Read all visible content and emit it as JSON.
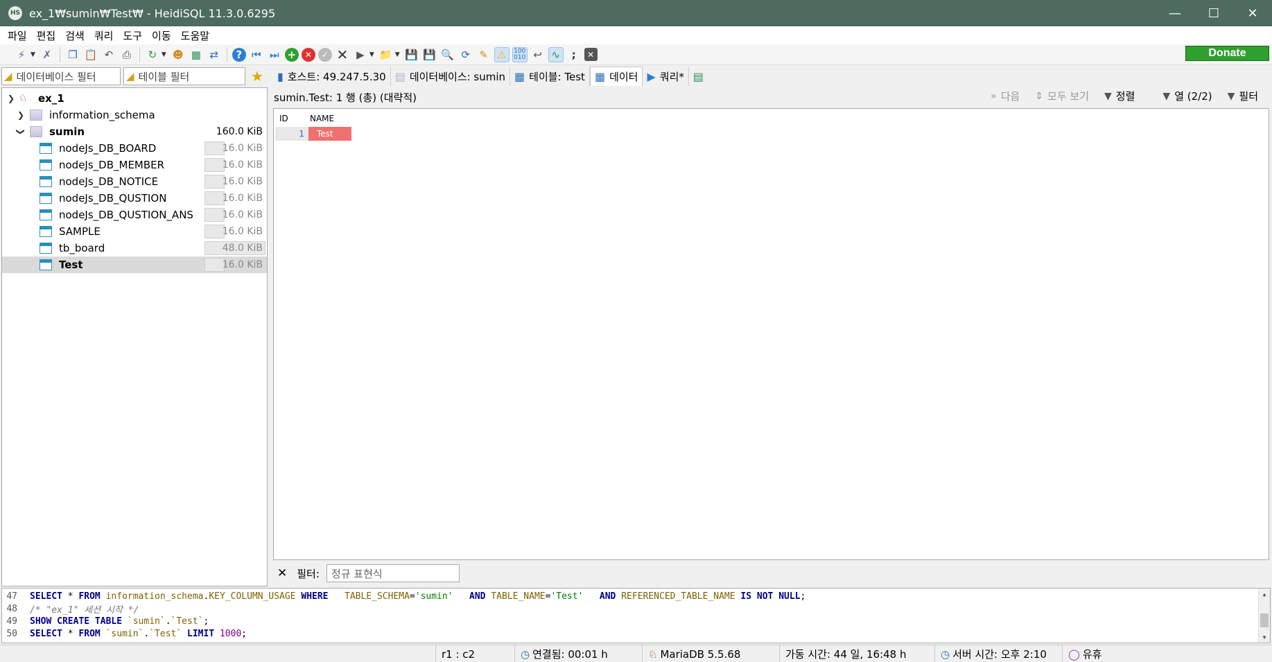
{
  "window": {
    "title": "ex_1₩sumin₩Test₩ - HeidiSQL 11.3.0.6295",
    "app_icon_text": "HS"
  },
  "menu": [
    "파일",
    "편집",
    "검색",
    "쿼리",
    "도구",
    "이동",
    "도움말"
  ],
  "toolbar": {
    "donate_label": "Donate"
  },
  "filters": {
    "db_filter_placeholder": "데이터베이스 필터",
    "table_filter_placeholder": "테이블 필터"
  },
  "tree": {
    "server": "ex_1",
    "databases": [
      {
        "name": "information_schema",
        "size": ""
      },
      {
        "name": "sumin",
        "size": "160.0 KiB"
      }
    ],
    "tables": [
      {
        "name": "nodeJs_DB_BOARD",
        "size": "16.0 KiB",
        "fill": 0.33
      },
      {
        "name": "nodeJs_DB_MEMBER",
        "size": "16.0 KiB",
        "fill": 0.33
      },
      {
        "name": "nodeJs_DB_NOTICE",
        "size": "16.0 KiB",
        "fill": 0.33
      },
      {
        "name": "nodeJs_DB_QUSTION",
        "size": "16.0 KiB",
        "fill": 0.33
      },
      {
        "name": "nodeJs_DB_QUSTION_ANS",
        "size": "16.0 KiB",
        "fill": 0.33
      },
      {
        "name": "SAMPLE",
        "size": "16.0 KiB",
        "fill": 0.33
      },
      {
        "name": "tb_board",
        "size": "48.0 KiB",
        "fill": 1.0
      },
      {
        "name": "Test",
        "size": "16.0 KiB",
        "fill": 0.33
      }
    ],
    "selected_table": "Test"
  },
  "tabs": [
    {
      "label": "호스트: 49.247.5.30"
    },
    {
      "label": "데이터베이스: sumin"
    },
    {
      "label": "테이블: Test"
    },
    {
      "label": "데이터"
    },
    {
      "label": "쿼리*"
    }
  ],
  "data_view": {
    "info": "sumin.Test: 1 행 (총) (대략적)",
    "next_label": "다음",
    "show_all_label": "모두 보기",
    "sort_label": "정렬",
    "columns_label": "열 (2/2)",
    "filter_label": "필터",
    "columns": [
      "ID",
      "NAME"
    ],
    "rows": [
      {
        "ID": "1",
        "NAME": "Test"
      }
    ]
  },
  "filter_row": {
    "label": "필터:",
    "placeholder": "정규 표현식"
  },
  "sql_log": [
    {
      "line": "47",
      "text": "SELECT * FROM information_schema.KEY_COLUMN_USAGE WHERE   TABLE_SCHEMA='sumin'   AND TABLE_NAME='Test'   AND REFERENCED_TABLE_NAME IS NOT NULL;"
    },
    {
      "line": "48",
      "text": "/* \"ex_1\" 세션 시작 */"
    },
    {
      "line": "49",
      "text": "SHOW CREATE TABLE `sumin`.`Test`;"
    },
    {
      "line": "50",
      "text": "SELECT * FROM `sumin`.`Test` LIMIT 1000;"
    }
  ],
  "status": {
    "cursor": "r1 : c2",
    "connected": "연결됨: 00:01 h",
    "server_version": "MariaDB 5.5.68",
    "uptime": "가동 시간: 44 일, 16:48 h",
    "server_time": "서버 시간: 오후 2:10",
    "state": "유휴"
  },
  "colors": {
    "titlebar": "#4d6b5f",
    "donate": "#2ea02e",
    "focused_cell": "#f07070"
  }
}
